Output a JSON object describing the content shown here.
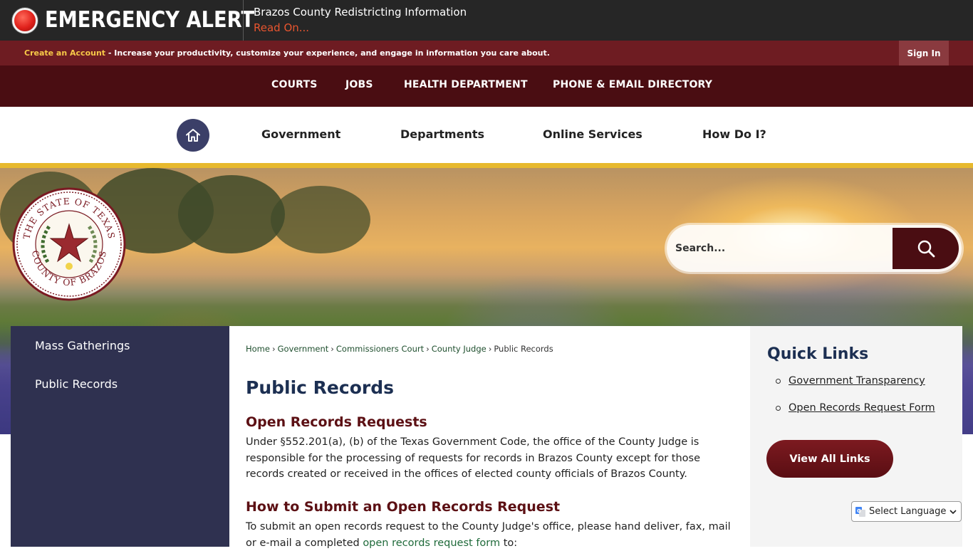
{
  "alert": {
    "title": "EMERGENCY ALERT",
    "headline": "Brazos County Redistricting Information",
    "read_on": "Read On..."
  },
  "account_bar": {
    "create_account_link": "Create an Account",
    "create_account_text": " - Increase your productivity, customize your experience, and engage in information you care about.",
    "sign_in": "Sign In"
  },
  "top_nav": {
    "items": [
      "COURTS",
      "JOBS",
      "HEALTH DEPARTMENT",
      "PHONE & EMAIL DIRECTORY"
    ]
  },
  "main_nav": {
    "items": [
      "Government",
      "Departments",
      "Online Services",
      "How Do I?"
    ]
  },
  "seal": {
    "top_text": "THE STATE OF TEXAS",
    "bottom_text": "COUNTY OF BRAZOS"
  },
  "search": {
    "placeholder": "Search..."
  },
  "sidebar": {
    "items": [
      "Mass Gatherings",
      "Public Records"
    ]
  },
  "breadcrumb": {
    "items": [
      "Home",
      "Government",
      "Commissioners Court",
      "County Judge"
    ],
    "current": "Public Records",
    "separator": "›"
  },
  "content": {
    "page_title": "Public Records",
    "section1_heading": "Open Records Requests",
    "section1_text": "Under §552.201(a), (b) of the Texas Government Code, the office of the County Judge is responsible for the processing of requests for records in Brazos County except for those records created or received in the offices of elected county officials of Brazos County.",
    "section2_heading": "How to Submit an Open Records Request",
    "section2_text_before": "To submit an open records request to the County Judge's office, please hand deliver, fax, mail or e-mail a completed ",
    "section2_link": "open records request form",
    "section2_text_after": " to:"
  },
  "quick_links": {
    "title": "Quick Links",
    "items": [
      "Government Transparency",
      "Open Records Request Form"
    ],
    "view_all": "View All Links"
  },
  "language": {
    "selected": "Select Language"
  },
  "colors": {
    "alert_bg": "#262626",
    "account_bar_bg": "#6e1c22",
    "top_nav_bg": "#4a0d12",
    "gold_stripe": "#e7b92e",
    "sidebar_bg": "#2f3150",
    "heading_blue": "#1c2f52",
    "heading_maroon": "#5c1014"
  }
}
